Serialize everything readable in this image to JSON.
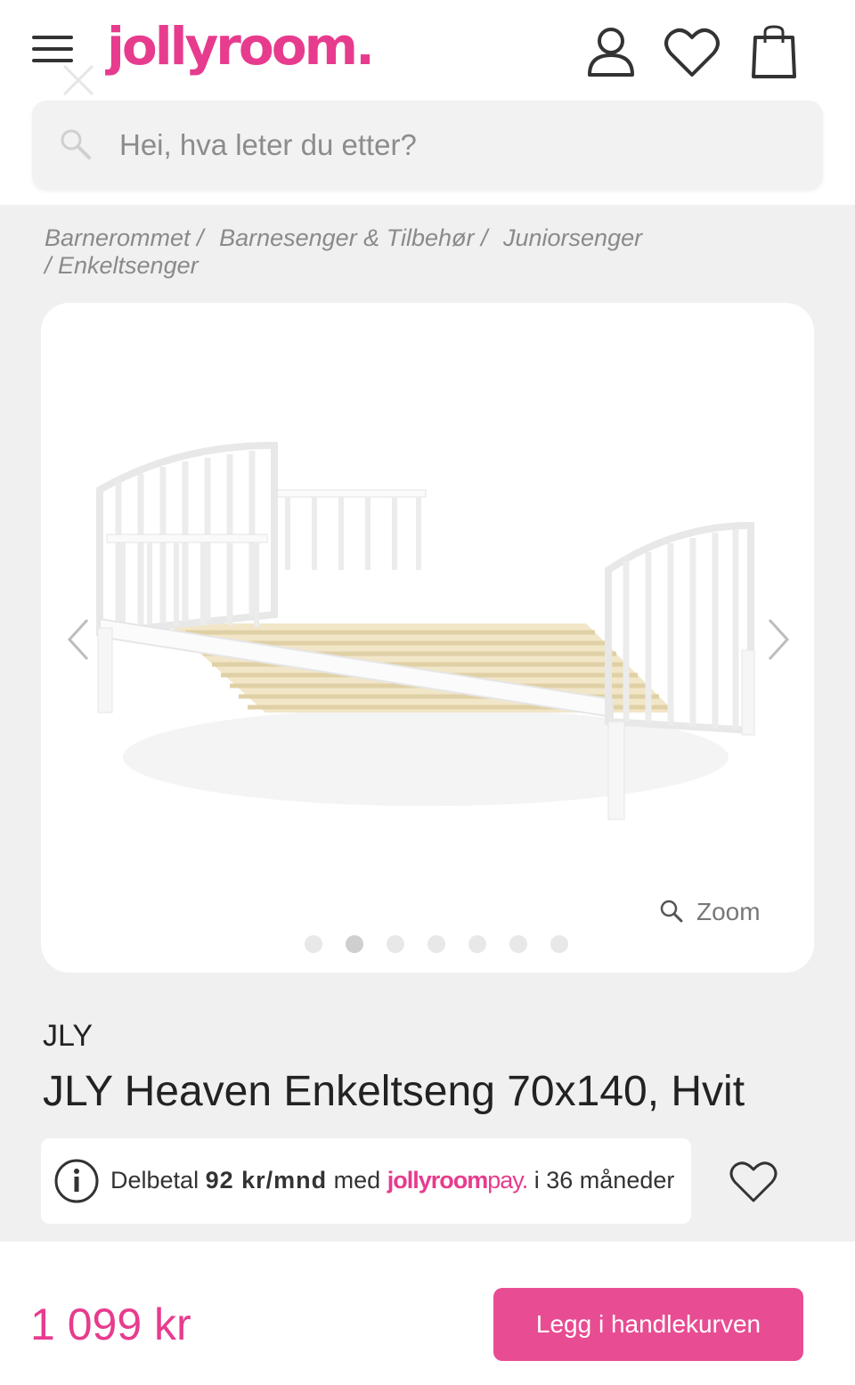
{
  "header": {
    "logo_text": "jollyroom.",
    "brand_color": "#e73c8e",
    "icons": [
      "menu-icon",
      "close-icon",
      "user-icon",
      "heart-icon",
      "shopping-bag-icon"
    ]
  },
  "search": {
    "placeholder": "Hei, hva leter du etter?"
  },
  "breadcrumb": {
    "items": [
      "Barnerommet /",
      "Barnesenger & Tilbehør /",
      "Juniorsenger",
      "/ Enkeltsenger"
    ]
  },
  "gallery": {
    "zoom_label": "Zoom",
    "image_count": 7,
    "active_index": 1
  },
  "product": {
    "brand": "JLY",
    "title": "JLY Heaven Enkeltseng 70x140, Hvit"
  },
  "payment": {
    "prefix": "Delbetal",
    "amount": "92 kr/mnd",
    "middle": "med",
    "logo_main": "jollyroom",
    "logo_suffix": "pay.",
    "suffix": "i 36 måneder"
  },
  "purchase": {
    "price": "1 099 kr",
    "cart_button": "Legg i handlekurven",
    "button_color": "#e84c93"
  }
}
